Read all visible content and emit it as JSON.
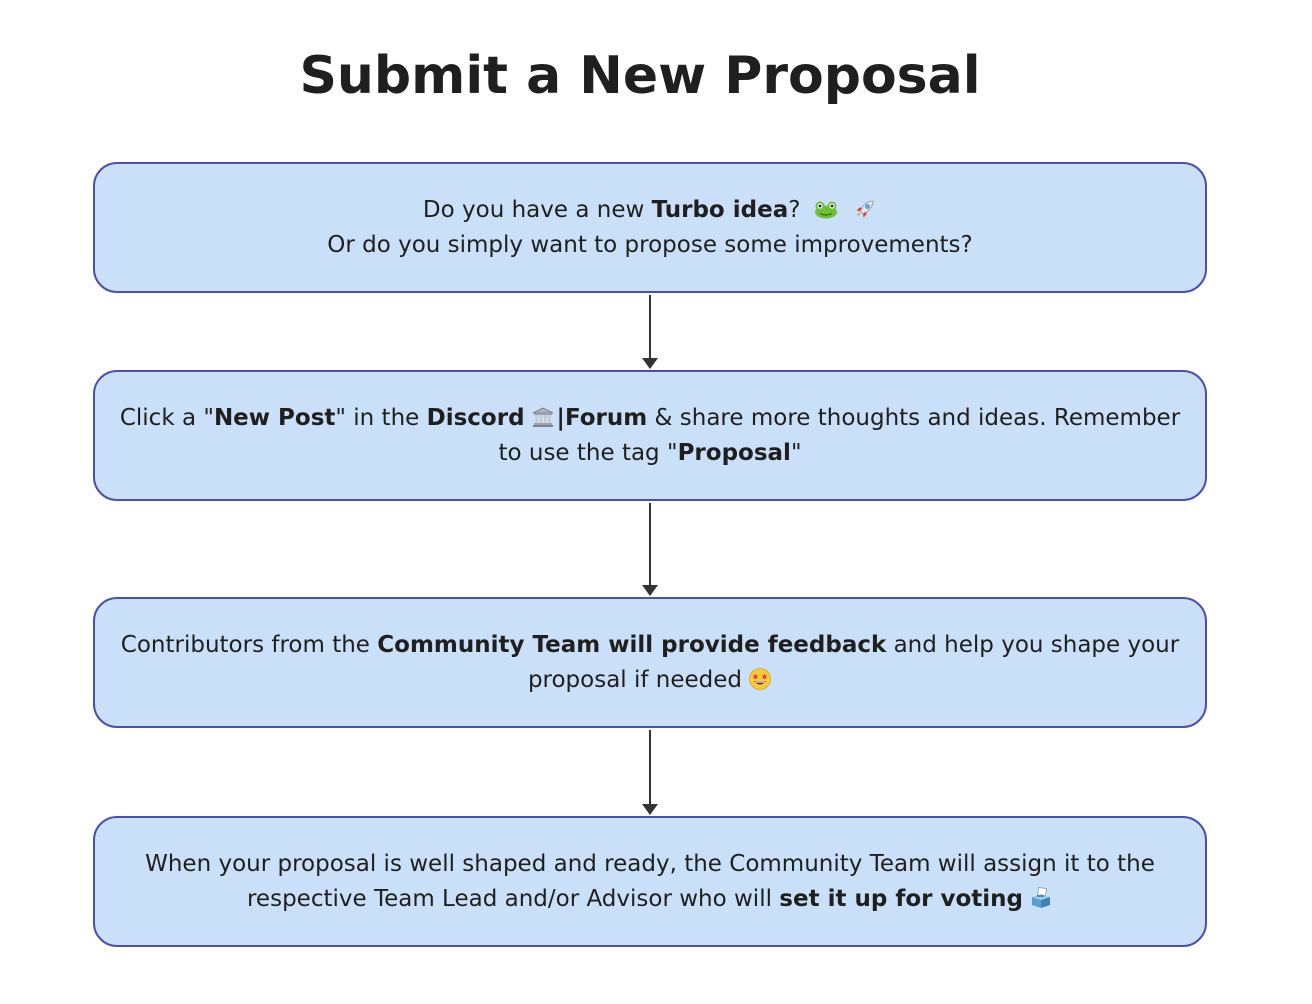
{
  "title": "Submit a New Proposal",
  "colors": {
    "box_fill": "#cae0f8",
    "box_border": "#4d4fb0",
    "arrow": "#333333",
    "text": "#1f1f1f"
  },
  "steps": [
    {
      "line1_a": "Do you have a new ",
      "line1_b": "Turbo idea",
      "line1_c": "?",
      "icons": [
        "frog-icon",
        "rocket-icon"
      ],
      "line2": "Or do you simply want to propose some improvements?"
    },
    {
      "a": "Click  a \"",
      "b": "New Post",
      "c": "\" in the ",
      "d": "Discord",
      "icon": "classical-building-icon",
      "e": "|Forum",
      "f": " & share more thoughts and ideas. Remember to use the tag \"",
      "g": "Proposal",
      "h": "\""
    },
    {
      "a": "Contributors from the ",
      "b": "Community Team will provide feedback",
      "c": " and help you shape your proposal if needed",
      "icon": "star-struck-icon"
    },
    {
      "a": "When your proposal is well shaped and ready, the Community Team will assign it to the respective Team Lead and/or Advisor who will ",
      "b": "set it up for voting",
      "icon": "ballot-box-icon"
    }
  ]
}
